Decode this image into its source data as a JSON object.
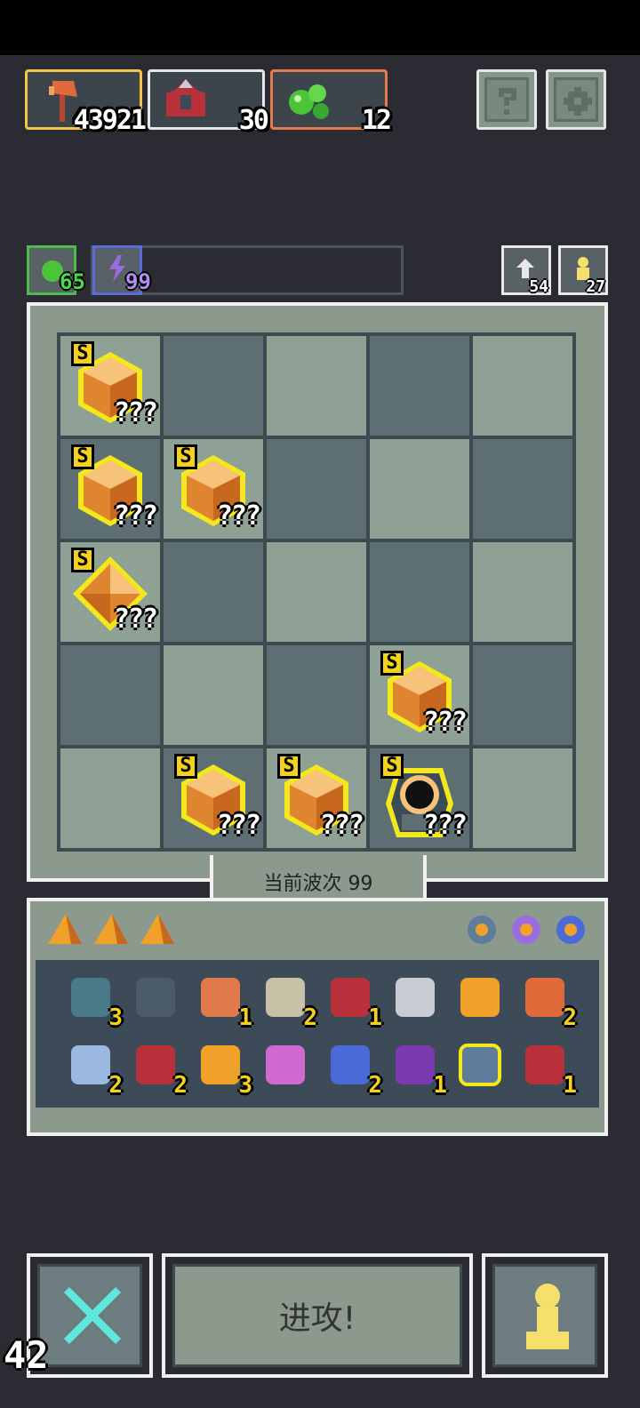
{
  "resources": {
    "attack": {
      "value": "43921",
      "icon": "axe-icon",
      "border": "#f5c24a"
    },
    "armor": {
      "value": "30",
      "icon": "armor-icon",
      "border": "#e8e8e8"
    },
    "potion": {
      "value": "12",
      "icon": "green-slime-icon",
      "border": "#e57a4a"
    }
  },
  "top_buttons": {
    "help_icon": "question-icon",
    "settings_icon": "gear-icon"
  },
  "stats": {
    "health": {
      "value": "65",
      "icon": "green-heart-icon",
      "border": "#4bbd4b"
    },
    "energy": {
      "value": "99",
      "icon": "lightning-icon",
      "border": "#5a6cd8"
    },
    "refresh": {
      "value": "54",
      "icon": "refresh-icon"
    },
    "pawn": {
      "value": "27",
      "icon": "pawn-icon"
    }
  },
  "board": {
    "grid": [
      [
        "gem-s",
        "light",
        "dark",
        "light",
        "dark"
      ],
      [
        "gem-s",
        "gem-s",
        "light",
        "dark",
        "light"
      ],
      [
        "gem-s-diamond",
        "light",
        "dark",
        "light",
        "dark"
      ],
      [
        "light",
        "dark",
        "light",
        "gem-s",
        "light"
      ],
      [
        "dark",
        "gem-s",
        "gem-s",
        "eye-s",
        "dark"
      ]
    ],
    "rank_label": "S",
    "unknown_label": "???"
  },
  "wave": {
    "label": "当前波次 99"
  },
  "inventory": {
    "shards": [
      "shard-icon",
      "shard-icon",
      "shard-icon"
    ],
    "top_right_icons": [
      "helmet-icon",
      "ring-purple-icon",
      "ring-blue-icon"
    ],
    "row1": [
      {
        "icon": "heart-gem-icon",
        "count": "3"
      },
      {
        "icon": "shield-icon",
        "count": ""
      },
      {
        "icon": "lantern-icon",
        "count": "1"
      },
      {
        "icon": "scroll-icon",
        "count": "2"
      },
      {
        "icon": "armor-icon",
        "count": "1"
      },
      {
        "icon": "sword-icon",
        "count": ""
      },
      {
        "icon": "crown-icon",
        "count": ""
      },
      {
        "icon": "axe-icon",
        "count": "2"
      }
    ],
    "row2": [
      {
        "icon": "crossbow-icon",
        "count": "2"
      },
      {
        "icon": "red-armor-icon",
        "count": "2"
      },
      {
        "icon": "orb-icon",
        "count": "3"
      },
      {
        "icon": "arrow-icon",
        "count": ""
      },
      {
        "icon": "hourglass-icon",
        "count": "2"
      },
      {
        "icon": "mask-icon",
        "count": "1"
      },
      {
        "icon": "spiked-crown-icon",
        "count": ""
      },
      {
        "icon": "helmet-armor-icon",
        "count": "1"
      }
    ]
  },
  "bottom": {
    "attack_button": "进攻!",
    "left_icon": "crossed-swords-icon",
    "right_icon": "pawn-icon",
    "corner_number": "42"
  }
}
